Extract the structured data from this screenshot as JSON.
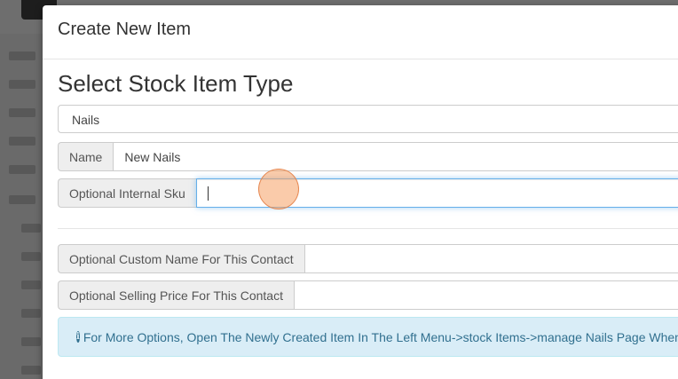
{
  "modal": {
    "title": "Create New Item",
    "section_title": "Select Stock Item Type",
    "stock_type_selected": "Nails",
    "fields": {
      "name": {
        "label": "Name",
        "value": "New Nails"
      },
      "internal_sku": {
        "label": "Optional Internal Sku",
        "value": ""
      },
      "custom_name": {
        "label": "Optional Custom Name For This Contact",
        "value": ""
      },
      "selling_price": {
        "label": "Optional Selling Price For This Contact",
        "value": ""
      }
    },
    "info_alert": {
      "icon": "info-icon",
      "icon_glyph": "i",
      "text": "For More Options, Open The Newly Created Item In The Left Menu->stock Items->manage Nails Page When You"
    }
  },
  "colors": {
    "focus_border": "#66afe9",
    "alert_background": "#d9edf7",
    "alert_text": "#31708f",
    "click_indicator": "#f5a064"
  }
}
